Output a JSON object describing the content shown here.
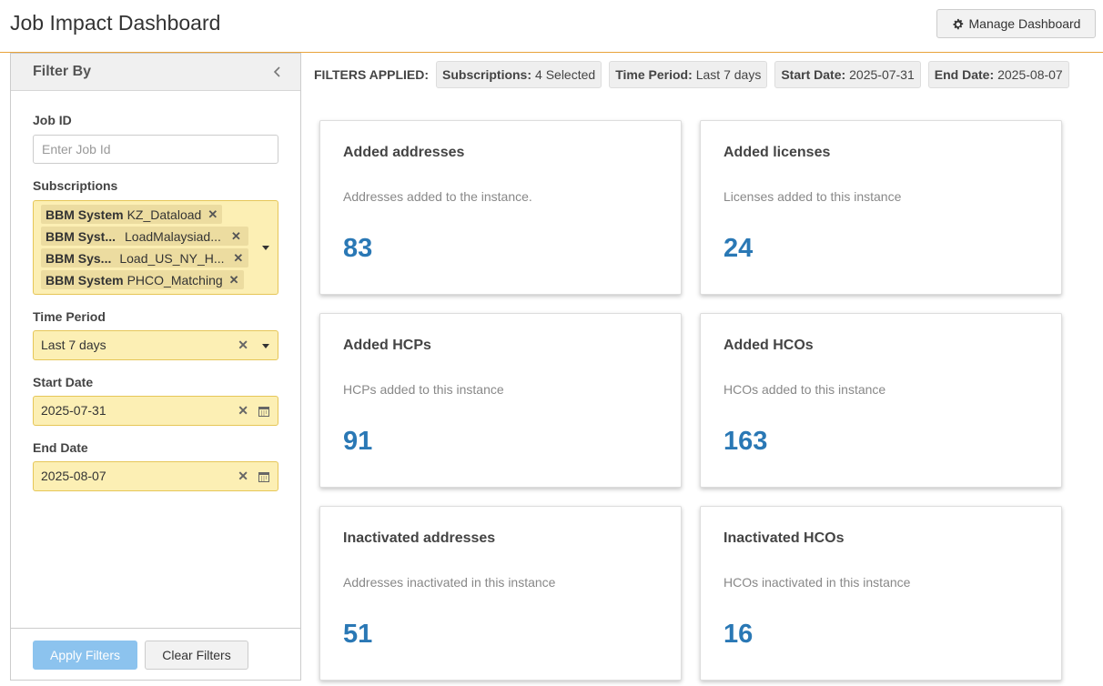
{
  "header": {
    "title": "Job Impact Dashboard",
    "manage_label": "Manage Dashboard"
  },
  "sidebar": {
    "title": "Filter By",
    "job_id": {
      "label": "Job ID",
      "placeholder": "Enter Job Id"
    },
    "subscriptions": {
      "label": "Subscriptions",
      "chips": [
        {
          "bold": "BBM System",
          "text": "KZ_Dataload"
        },
        {
          "bold": "BBM Syst...",
          "text": "LoadMalaysiad..."
        },
        {
          "bold": "BBM Sys...",
          "text": "Load_US_NY_H..."
        },
        {
          "bold": "BBM System",
          "text": "PHCO_Matching"
        }
      ]
    },
    "time_period": {
      "label": "Time Period",
      "value": "Last 7 days"
    },
    "start_date": {
      "label": "Start Date",
      "value": "2025-07-31"
    },
    "end_date": {
      "label": "End Date",
      "value": "2025-08-07"
    },
    "apply_label": "Apply Filters",
    "clear_label": "Clear Filters"
  },
  "filters_applied": {
    "label": "FILTERS APPLIED:",
    "tags": [
      {
        "key": "Subscriptions:",
        "value": "4 Selected"
      },
      {
        "key": "Time Period:",
        "value": "Last 7 days"
      },
      {
        "key": "Start Date:",
        "value": "2025-07-31"
      },
      {
        "key": "End Date:",
        "value": "2025-08-07"
      }
    ]
  },
  "cards": [
    {
      "title": "Added addresses",
      "desc": "Addresses added to the instance.",
      "value": "83"
    },
    {
      "title": "Added licenses",
      "desc": "Licenses added to this instance",
      "value": "24"
    },
    {
      "title": "Added HCPs",
      "desc": "HCPs added to this instance",
      "value": "91"
    },
    {
      "title": "Added HCOs",
      "desc": "HCOs added to this instance",
      "value": "163"
    },
    {
      "title": "Inactivated addresses",
      "desc": "Addresses inactivated in this instance",
      "value": "51"
    },
    {
      "title": "Inactivated HCOs",
      "desc": "HCOs inactivated in this instance",
      "value": "16"
    }
  ],
  "colors": {
    "accent_orange": "#e8a33b",
    "highlight_fill": "#fcefb4",
    "metric_blue": "#2a78b5",
    "apply_blue": "#8cc3ee"
  }
}
